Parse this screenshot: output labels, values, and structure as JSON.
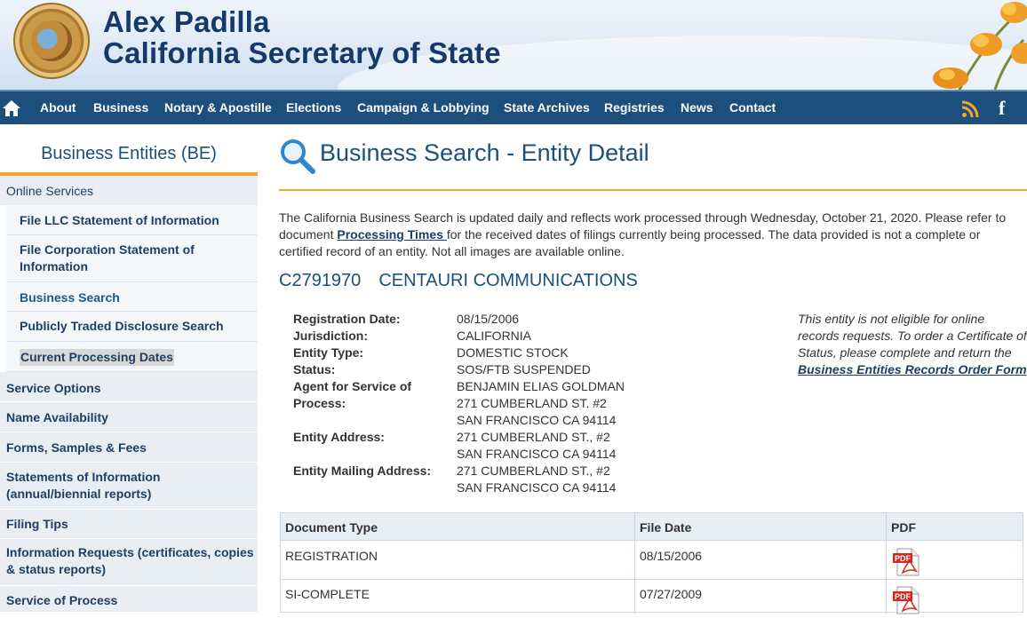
{
  "header": {
    "name": "Alex Padilla",
    "office": "California Secretary of State"
  },
  "nav": {
    "items": [
      "About",
      "Business",
      "Notary & Apostille",
      "Elections",
      "Campaign & Lobbying",
      "State Archives",
      "Registries",
      "News",
      "Contact"
    ],
    "facebook_glyph": "f"
  },
  "sidebar": {
    "title": "Business Entities (BE)",
    "online_services": "Online Services",
    "sub_items": [
      "File LLC Statement of Information",
      "File Corporation Statement of Information",
      "Business Search",
      "Publicly Traded Disclosure Search",
      "Current Processing Dates"
    ],
    "sections": [
      "Service Options",
      "Name Availability",
      "Forms, Samples & Fees",
      "Statements of Information (annual/biennial reports)",
      "Filing Tips",
      "Information Requests (certificates, copies & status reports)",
      "Service of Process"
    ]
  },
  "main": {
    "title": "Business Search - Entity Detail",
    "intro_before": "The California Business Search is updated daily and reflects work processed through Wednesday, October 21, 2020. Please refer to document ",
    "intro_link": "Processing Times ",
    "intro_after": "for the received dates of filings currently being processed. The data provided is not a complete or certified record of an entity. Not all images are available online.",
    "entity_number": "C2791970",
    "entity_name": "CENTAURI COMMUNICATIONS",
    "details": {
      "registration_date_label": "Registration Date:",
      "registration_date": "08/15/2006",
      "jurisdiction_label": "Jurisdiction:",
      "jurisdiction": "CALIFORNIA",
      "entity_type_label": "Entity Type:",
      "entity_type": "DOMESTIC STOCK",
      "status_label": "Status:",
      "status": "SOS/FTB SUSPENDED",
      "agent_label_1": "Agent for Service of",
      "agent_label_2": "Process:",
      "agent_name": "BENJAMIN ELIAS GOLDMAN",
      "agent_address_1": "271 CUMBERLAND ST. #2",
      "agent_address_2": "SAN FRANCISCO CA 94114",
      "entity_address_label": "Entity Address:",
      "entity_address_1": "271 CUMBERLAND ST., #2",
      "entity_address_2": "SAN FRANCISCO CA 94114",
      "mailing_address_label": "Entity Mailing Address:",
      "mailing_address_1": "271 CUMBERLAND ST., #2",
      "mailing_address_2": "SAN FRANCISCO CA 94114"
    },
    "notice_text": "This entity is not eligible for online records requests. To order a Certificate of Status, please complete and return the ",
    "notice_link": "Business Entities Records Order Form",
    "table": {
      "headers": [
        "Document Type",
        "File Date",
        "PDF"
      ],
      "rows": [
        {
          "type": "REGISTRATION",
          "date": "08/15/2006"
        },
        {
          "type": "SI-COMPLETE",
          "date": "07/27/2009"
        }
      ]
    }
  },
  "colors": {
    "brand_navy": "#14396a",
    "nav_bg": "#1d4f7c",
    "accent_orange": "#f2a92b",
    "pdf_red": "#d8261c"
  }
}
